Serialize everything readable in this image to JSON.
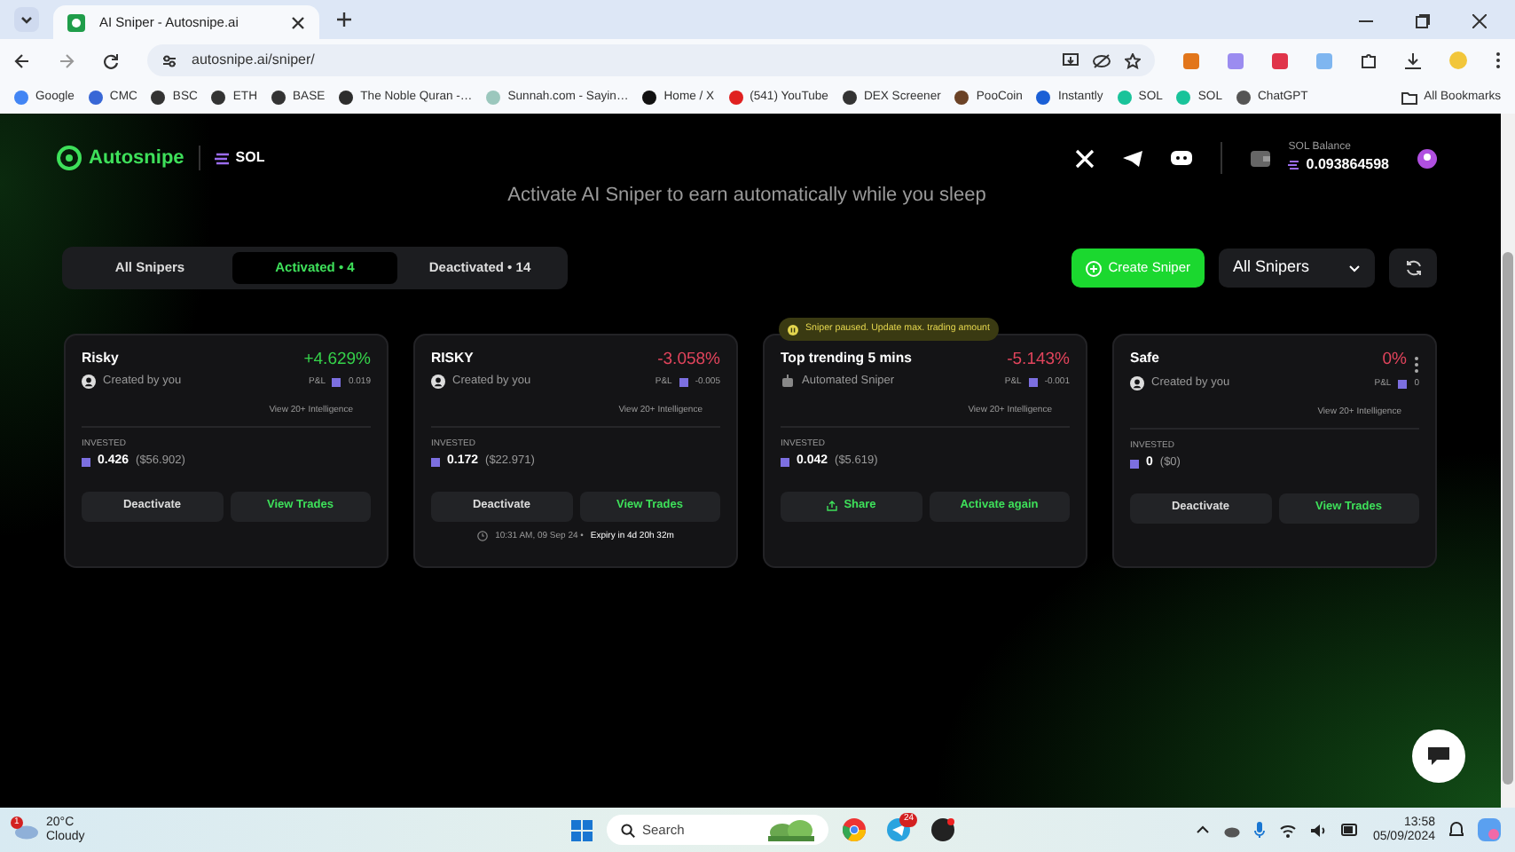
{
  "browser": {
    "tab_title": "AI Sniper - Autosnipe.ai",
    "url": "autosnipe.ai/sniper/",
    "bookmarks": [
      "Google",
      "CMC",
      "BSC",
      "ETH",
      "BASE",
      "The Noble Quran -…",
      "Sunnah.com - Sayin…",
      "Home / X",
      "(541) YouTube",
      "DEX Screener",
      "PooCoin",
      "Instantly",
      "SOL",
      "SOL",
      "ChatGPT"
    ],
    "all_bookmarks": "All Bookmarks"
  },
  "header": {
    "logo": "Autosnipe",
    "chain": "SOL",
    "balance_label": "SOL Balance",
    "balance": "0.093864598"
  },
  "subtitle": "Activate AI Sniper to earn automatically while you sleep",
  "filters": [
    {
      "label": "All Snipers",
      "selected": false
    },
    {
      "label": "Activated • 4",
      "selected": true
    },
    {
      "label": "Deactivated • 14",
      "selected": false
    }
  ],
  "create_button": "Create Sniper",
  "dropdown": "All Snipers",
  "cards": [
    {
      "name": "Risky",
      "change": "+4.629%",
      "color": "#35d24a",
      "creator": {
        "kind": "user",
        "text": "Created by you"
      },
      "pnl_label": "P&L",
      "pnl": "0.019",
      "intelligence": "View 20+ Intelligence",
      "invested_label": "INVESTED",
      "invested": "0.426",
      "invested_usd": "($56.902)",
      "buttons": [
        {
          "label": "Deactivate",
          "kind": "plain"
        },
        {
          "label": "View Trades",
          "kind": "accent"
        }
      ]
    },
    {
      "name": "RISKY",
      "change": "-3.058%",
      "color": "#e2445c",
      "creator": {
        "kind": "user",
        "text": "Created by you"
      },
      "pnl_label": "P&L",
      "pnl": "-0.005",
      "intelligence": "View 20+ Intelligence",
      "invested_label": "INVESTED",
      "invested": "0.172",
      "invested_usd": "($22.971)",
      "buttons": [
        {
          "label": "Deactivate",
          "kind": "plain"
        },
        {
          "label": "View Trades",
          "kind": "accent"
        }
      ],
      "footer": {
        "time": "10:31 AM, 09 Sep 24 •",
        "expiry": "Expiry in 4d 20h 32m"
      }
    },
    {
      "name": "Top trending 5 mins",
      "change": "-5.143%",
      "color": "#e2445c",
      "banner": "Sniper paused. Update max. trading amount",
      "creator": {
        "kind": "bot",
        "text": "Automated Sniper"
      },
      "pnl_label": "P&L",
      "pnl": "-0.001",
      "intelligence": "View 20+ Intelligence",
      "invested_label": "INVESTED",
      "invested": "0.042",
      "invested_usd": "($5.619)",
      "buttons": [
        {
          "label": "Share",
          "kind": "share"
        },
        {
          "label": "Activate again",
          "kind": "accent"
        }
      ]
    },
    {
      "name": "Safe",
      "change": "0%",
      "color": "#e2445c",
      "menu": true,
      "creator": {
        "kind": "user",
        "text": "Created by you"
      },
      "pnl_label": "P&L",
      "pnl": "0",
      "intelligence": "View 20+ Intelligence",
      "invested_label": "INVESTED",
      "invested": "0",
      "invested_usd": "($0)",
      "buttons": [
        {
          "label": "Deactivate",
          "kind": "plain"
        },
        {
          "label": "View Trades",
          "kind": "accent"
        }
      ]
    }
  ],
  "taskbar": {
    "weather_badge": "1",
    "temperature": "20°C",
    "condition": "Cloudy",
    "search": "Search",
    "telegram_badge": "24",
    "time": "13:58",
    "date": "05/09/2024"
  }
}
